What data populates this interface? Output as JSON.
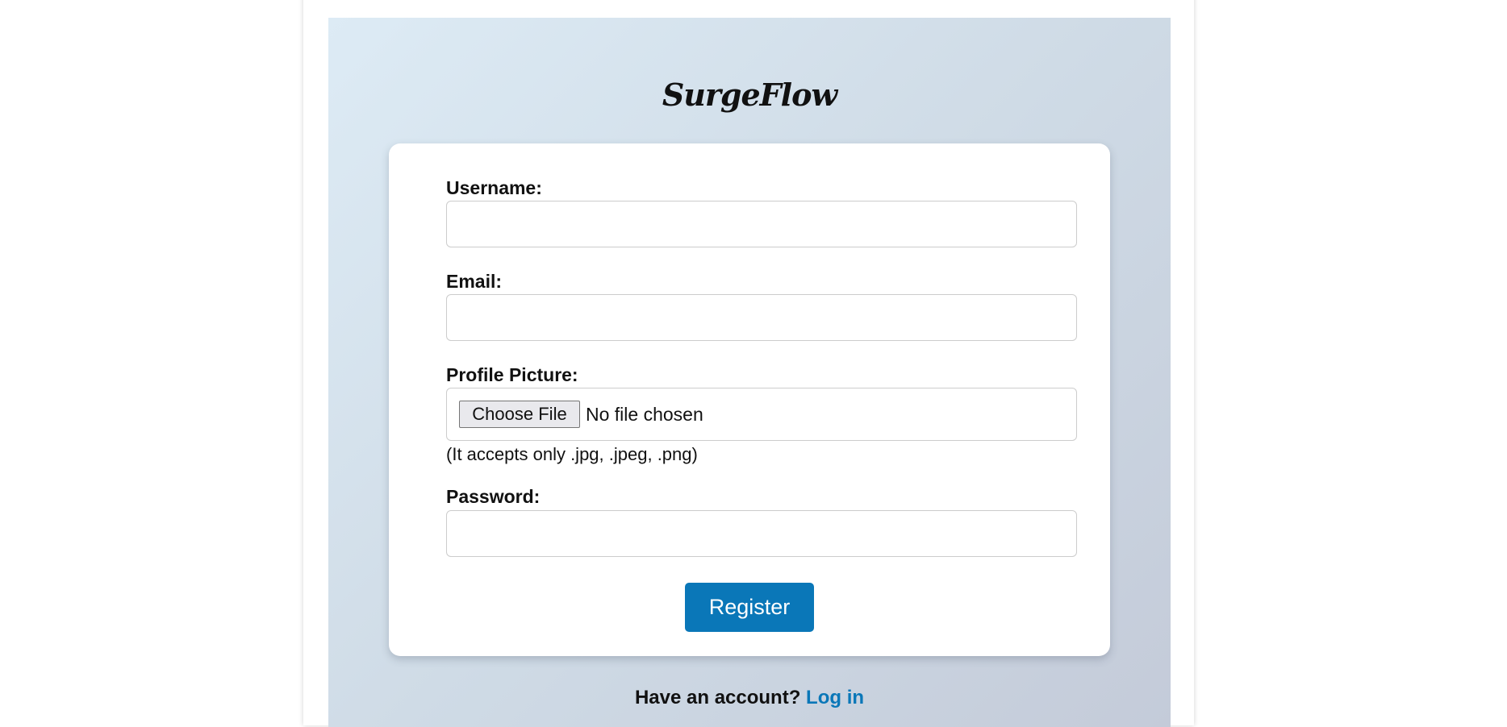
{
  "brand": {
    "name": "SurgeFlow"
  },
  "form": {
    "username_label": "Username:",
    "email_label": "Email:",
    "profile_picture_label": "Profile Picture:",
    "file_button_label": "Choose File",
    "file_status": "No file chosen",
    "file_hint": "(It accepts only .jpg, .jpeg, .png)",
    "password_label": "Password:",
    "register_label": "Register"
  },
  "footer": {
    "prompt": "Have an account?",
    "login_label": "Log in"
  },
  "colors": {
    "accent": "#0a77b8"
  }
}
